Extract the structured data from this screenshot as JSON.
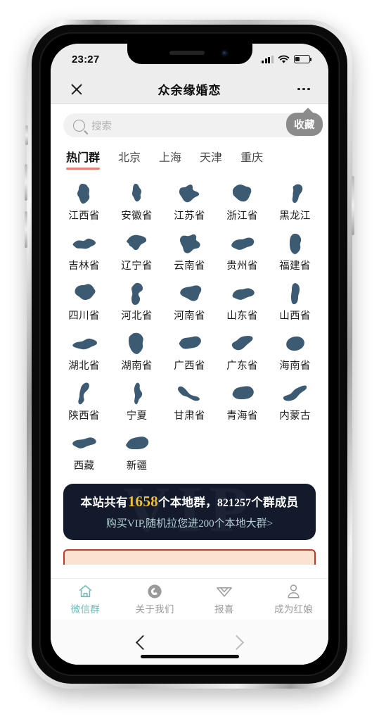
{
  "status_bar": {
    "time": "23:27",
    "signal_icon": "signal-bars-icon",
    "wifi_icon": "wifi-icon",
    "battery_icon": "battery-icon"
  },
  "header": {
    "close_icon": "close-icon",
    "title": "众余缘婚恋",
    "more_icon": "more-options-icon"
  },
  "search": {
    "icon": "search-icon",
    "placeholder": "搜索",
    "value": ""
  },
  "favorite_badge": {
    "label": "收藏"
  },
  "tabs": [
    {
      "label": "热门群",
      "active": true
    },
    {
      "label": "北京",
      "active": false
    },
    {
      "label": "上海",
      "active": false
    },
    {
      "label": "天津",
      "active": false
    },
    {
      "label": "重庆",
      "active": false
    }
  ],
  "provinces": [
    {
      "label": "江西省",
      "icon": "jiangxi-map-icon"
    },
    {
      "label": "安徽省",
      "icon": "anhui-map-icon"
    },
    {
      "label": "江苏省",
      "icon": "jiangsu-map-icon"
    },
    {
      "label": "浙江省",
      "icon": "zhejiang-map-icon"
    },
    {
      "label": "黑龙江",
      "icon": "heilongjiang-map-icon"
    },
    {
      "label": "吉林省",
      "icon": "jilin-map-icon"
    },
    {
      "label": "辽宁省",
      "icon": "liaoning-map-icon"
    },
    {
      "label": "云南省",
      "icon": "yunnan-map-icon"
    },
    {
      "label": "贵州省",
      "icon": "guizhou-map-icon"
    },
    {
      "label": "福建省",
      "icon": "fujian-map-icon"
    },
    {
      "label": "四川省",
      "icon": "sichuan-map-icon"
    },
    {
      "label": "河北省",
      "icon": "hebei-map-icon"
    },
    {
      "label": "河南省",
      "icon": "henan-map-icon"
    },
    {
      "label": "山东省",
      "icon": "shandong-map-icon"
    },
    {
      "label": "山西省",
      "icon": "shanxi-map-icon"
    },
    {
      "label": "湖北省",
      "icon": "hubei-map-icon"
    },
    {
      "label": "湖南省",
      "icon": "hunan-map-icon"
    },
    {
      "label": "广西省",
      "icon": "guangxi-map-icon"
    },
    {
      "label": "广东省",
      "icon": "guangdong-map-icon"
    },
    {
      "label": "海南省",
      "icon": "hainan-map-icon"
    },
    {
      "label": "陕西省",
      "icon": "shaanxi-map-icon"
    },
    {
      "label": "宁夏",
      "icon": "ningxia-map-icon"
    },
    {
      "label": "甘肃省",
      "icon": "gansu-map-icon"
    },
    {
      "label": "青海省",
      "icon": "qinghai-map-icon"
    },
    {
      "label": "内蒙古",
      "icon": "neimenggu-map-icon"
    },
    {
      "label": "西藏",
      "icon": "xizang-map-icon"
    },
    {
      "label": "新疆",
      "icon": "xinjiang-map-icon"
    }
  ],
  "banner": {
    "watermark": "VIP",
    "line1_prefix": "本站共有",
    "group_count": "1658",
    "line1_mid": "个本地群，",
    "member_count": "821257",
    "line1_suffix": "个群成员",
    "line2": "购买VIP,随机拉您进200个本地大群>",
    "bg_color": "#121a2c",
    "highlight_color": "#f0c02e",
    "subtitle_color": "#b8cfd6"
  },
  "bottom_nav": [
    {
      "label": "微信群",
      "icon": "home-icon",
      "active": true
    },
    {
      "label": "关于我们",
      "icon": "about-circle-icon",
      "active": false
    },
    {
      "label": "报喜",
      "icon": "diamond-icon",
      "active": false
    },
    {
      "label": "成为红娘",
      "icon": "person-icon",
      "active": false
    }
  ],
  "browser_nav": {
    "back_icon": "chevron-left-icon",
    "forward_icon": "chevron-right-icon"
  },
  "theme": {
    "accent": "#6cbdb8",
    "tab_underline": "#e8826e",
    "map_fill": "#3d5a73",
    "red_card_border": "#c0392b"
  }
}
